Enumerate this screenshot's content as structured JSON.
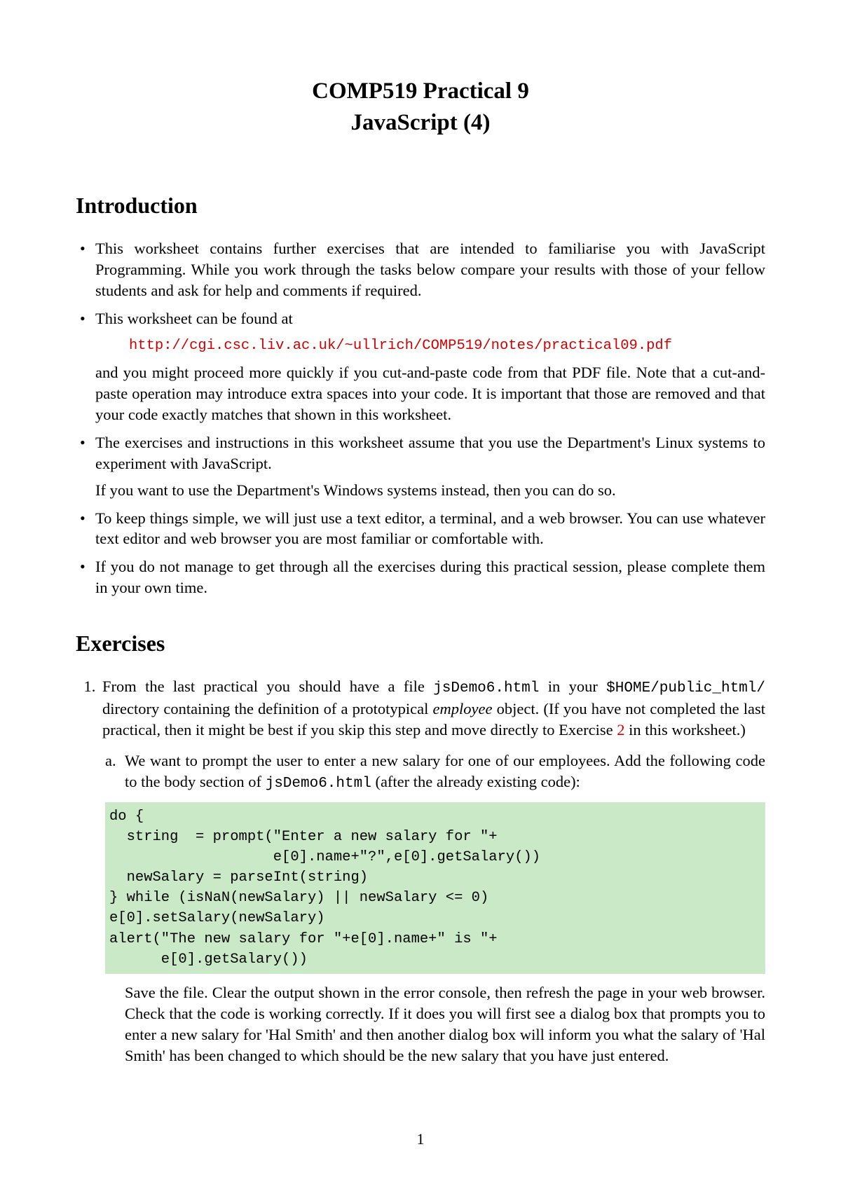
{
  "title": {
    "line1": "COMP519 Practical 9",
    "line2": "JavaScript (4)"
  },
  "sections": {
    "introduction_heading": "Introduction",
    "exercises_heading": "Exercises"
  },
  "intro_bullets": {
    "b1": "This worksheet contains further exercises that are intended to familiarise you with JavaScript Programming. While you work through the tasks below compare your results with those of your fellow students and ask for help and comments if required.",
    "b2_pre": "This worksheet can be found at",
    "b2_url": "http://cgi.csc.liv.ac.uk/~ullrich/COMP519/notes/practical09.pdf",
    "b2_post": "and you might proceed more quickly if you cut-and-paste code from that PDF file. Note that a cut-and-paste operation may introduce extra spaces into your code. It is important that those are removed and that your code exactly matches that shown in this worksheet.",
    "b3_p1": "The exercises and instructions in this worksheet assume that you use the Department's Linux systems to experiment with JavaScript.",
    "b3_p2": "If you want to use the Department's Windows systems instead, then you can do so.",
    "b4": "To keep things simple, we will just use a text editor, a terminal, and a web browser. You can use whatever text editor and web browser you are most familiar or comfortable with.",
    "b5": "If you do not manage to get through all the exercises during this practical session, please complete them in your own time."
  },
  "exercise1": {
    "frag1": "From the last practical you should have a file ",
    "code1": "jsDemo6.html",
    "frag2": " in your ",
    "code2": "$HOME/public_html/",
    "frag3": " directory containing the definition of a prototypical ",
    "italic": "employee",
    "frag4": " object. (If you have not completed the last practical, then it might be best if you skip this step and move directly to Exercise ",
    "linkref": "2",
    "frag5": " in this worksheet.)",
    "sub_a": {
      "marker": "a.",
      "frag1": "We want to prompt the user to enter a new salary for one of our employees. Add the following code to the body section of ",
      "code1": "jsDemo6.html",
      "frag2": " (after the already existing code):",
      "codeblock": "do {\n  string  = prompt(\"Enter a new salary for \"+\n                   e[0].name+\"?\",e[0].getSalary())\n  newSalary = parseInt(string)\n} while (isNaN(newSalary) || newSalary <= 0)\ne[0].setSalary(newSalary)\nalert(\"The new salary for \"+e[0].name+\" is \"+\n      e[0].getSalary())",
      "post": "Save the file. Clear the output shown in the error console, then refresh the page in your web browser. Check that the code is working correctly. If it does you will first see a dialog box that prompts you to enter a new salary for 'Hal Smith' and then another dialog box will inform you what the salary of 'Hal Smith' has been changed to which should be the new salary that you have just entered."
    }
  },
  "page_number": "1"
}
